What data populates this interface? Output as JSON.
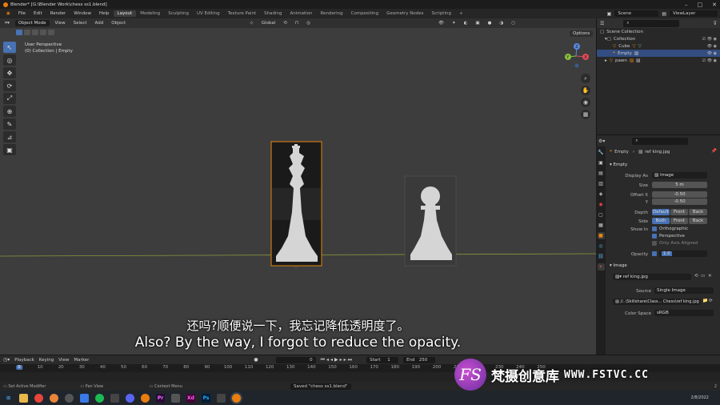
{
  "titlebar": {
    "title": "Blender* [G:\\Blender Work\\chess ss1.blend]"
  },
  "menu": {
    "items": [
      "File",
      "Edit",
      "Render",
      "Window",
      "Help"
    ],
    "workspaces": [
      "Layout",
      "Modeling",
      "Sculpting",
      "UV Editing",
      "Texture Paint",
      "Shading",
      "Animation",
      "Rendering",
      "Compositing",
      "Geometry Nodes",
      "Scripting"
    ],
    "add_tab": "+",
    "scene": "Scene",
    "view_layer": "ViewLayer"
  },
  "viewport_header": {
    "mode": "Object Mode",
    "items": [
      "View",
      "Select",
      "Add",
      "Object"
    ],
    "transform": "Global",
    "options": "Options"
  },
  "viewport": {
    "info_line1": "User Perspective",
    "info_line2": "(0) Collection | Empty",
    "gizmo": {
      "x": "X",
      "y": "Y",
      "z": "Z"
    }
  },
  "outliner": {
    "rows": [
      {
        "label": "Scene Collection"
      },
      {
        "label": "Collection"
      },
      {
        "label": "Cube"
      },
      {
        "label": "Empty"
      },
      {
        "label": "pawn"
      }
    ]
  },
  "properties": {
    "object_name": "Empty",
    "image_name": "ref king.jpg",
    "panel_empty": "Empty",
    "display_as_label": "Display As",
    "display_as_value": "Image",
    "size_label": "Size",
    "size_value": "5 m",
    "offset_x_label": "Offset X",
    "offset_x_value": "-0.50",
    "offset_y_label": "Y",
    "offset_y_value": "-0.50",
    "depth_label": "Depth",
    "depth_options": [
      "Default",
      "Front",
      "Back"
    ],
    "side_label": "Side",
    "side_options": [
      "Both",
      "Front",
      "Back"
    ],
    "show_in_label": "Show In",
    "show_orthographic": "Orthographic",
    "show_perspective": "Perspective",
    "only_axis_aligned": "Only Axis Aligned",
    "opacity_label": "Opacity",
    "opacity_value": "1.0",
    "panel_image": "Image",
    "image_field": "ref king.jpg",
    "source_label": "Source",
    "source_value": "Single Image",
    "filepath": "//..\\Skillshare\\Class... Chess\\ref king.jpg",
    "colorspace_label": "Color Space",
    "colorspace_value": "sRGB"
  },
  "timeline": {
    "menu": [
      "Playback",
      "Keying",
      "View",
      "Marker"
    ],
    "current_frame": "0",
    "start_label": "Start",
    "start": "1",
    "end_label": "End",
    "end": "250",
    "ticks": [
      "0",
      "10",
      "20",
      "30",
      "40",
      "50",
      "60",
      "70",
      "80",
      "90",
      "100",
      "110",
      "120",
      "130",
      "140",
      "150",
      "160",
      "170",
      "180",
      "190",
      "200",
      "210",
      "220",
      "230",
      "240",
      "250"
    ]
  },
  "statusbar": {
    "left": "Set Active Modifier",
    "mid": "Pan View",
    "ctx": "Context Menu",
    "saved": "Saved \"chess ss1.blend\"",
    "date": "2/8/2022",
    "version": "2"
  },
  "subtitles": {
    "cn": "还吗?顺便说一下，我忘记降低透明度了。",
    "en": "Also? By the way, I forgot to reduce the opacity."
  },
  "watermark": {
    "logo": "FS",
    "text": "梵摄创意库",
    "url": "WWW.FSTVC.CC"
  },
  "colors": {
    "accent": "#4772b3",
    "selection_orange": "#e8870f"
  }
}
